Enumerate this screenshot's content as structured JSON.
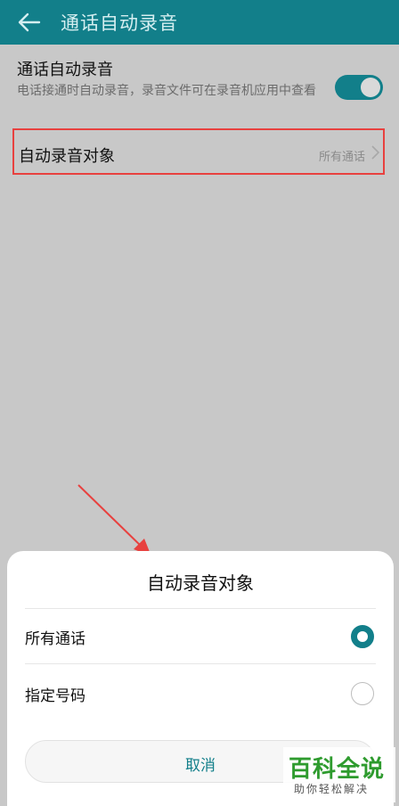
{
  "header": {
    "title": "通话自动录音",
    "back_icon": "back-arrow-icon"
  },
  "setting": {
    "title": "通话自动录音",
    "description": "电话接通时自动录音，录音文件可在录音机应用中查看",
    "toggle_on": true
  },
  "target": {
    "label": "自动录音对象",
    "value": "所有通话"
  },
  "dialog": {
    "title": "自动录音对象",
    "options": [
      {
        "label": "所有通话",
        "selected": true
      },
      {
        "label": "指定号码",
        "selected": false
      }
    ],
    "cancel_label": "取消"
  },
  "watermark": {
    "main": "百科全说",
    "sub": "助你轻松解决"
  },
  "colors": {
    "primary": "#127f8a",
    "highlight": "#e8413f",
    "watermark": "#2e9b2e"
  }
}
